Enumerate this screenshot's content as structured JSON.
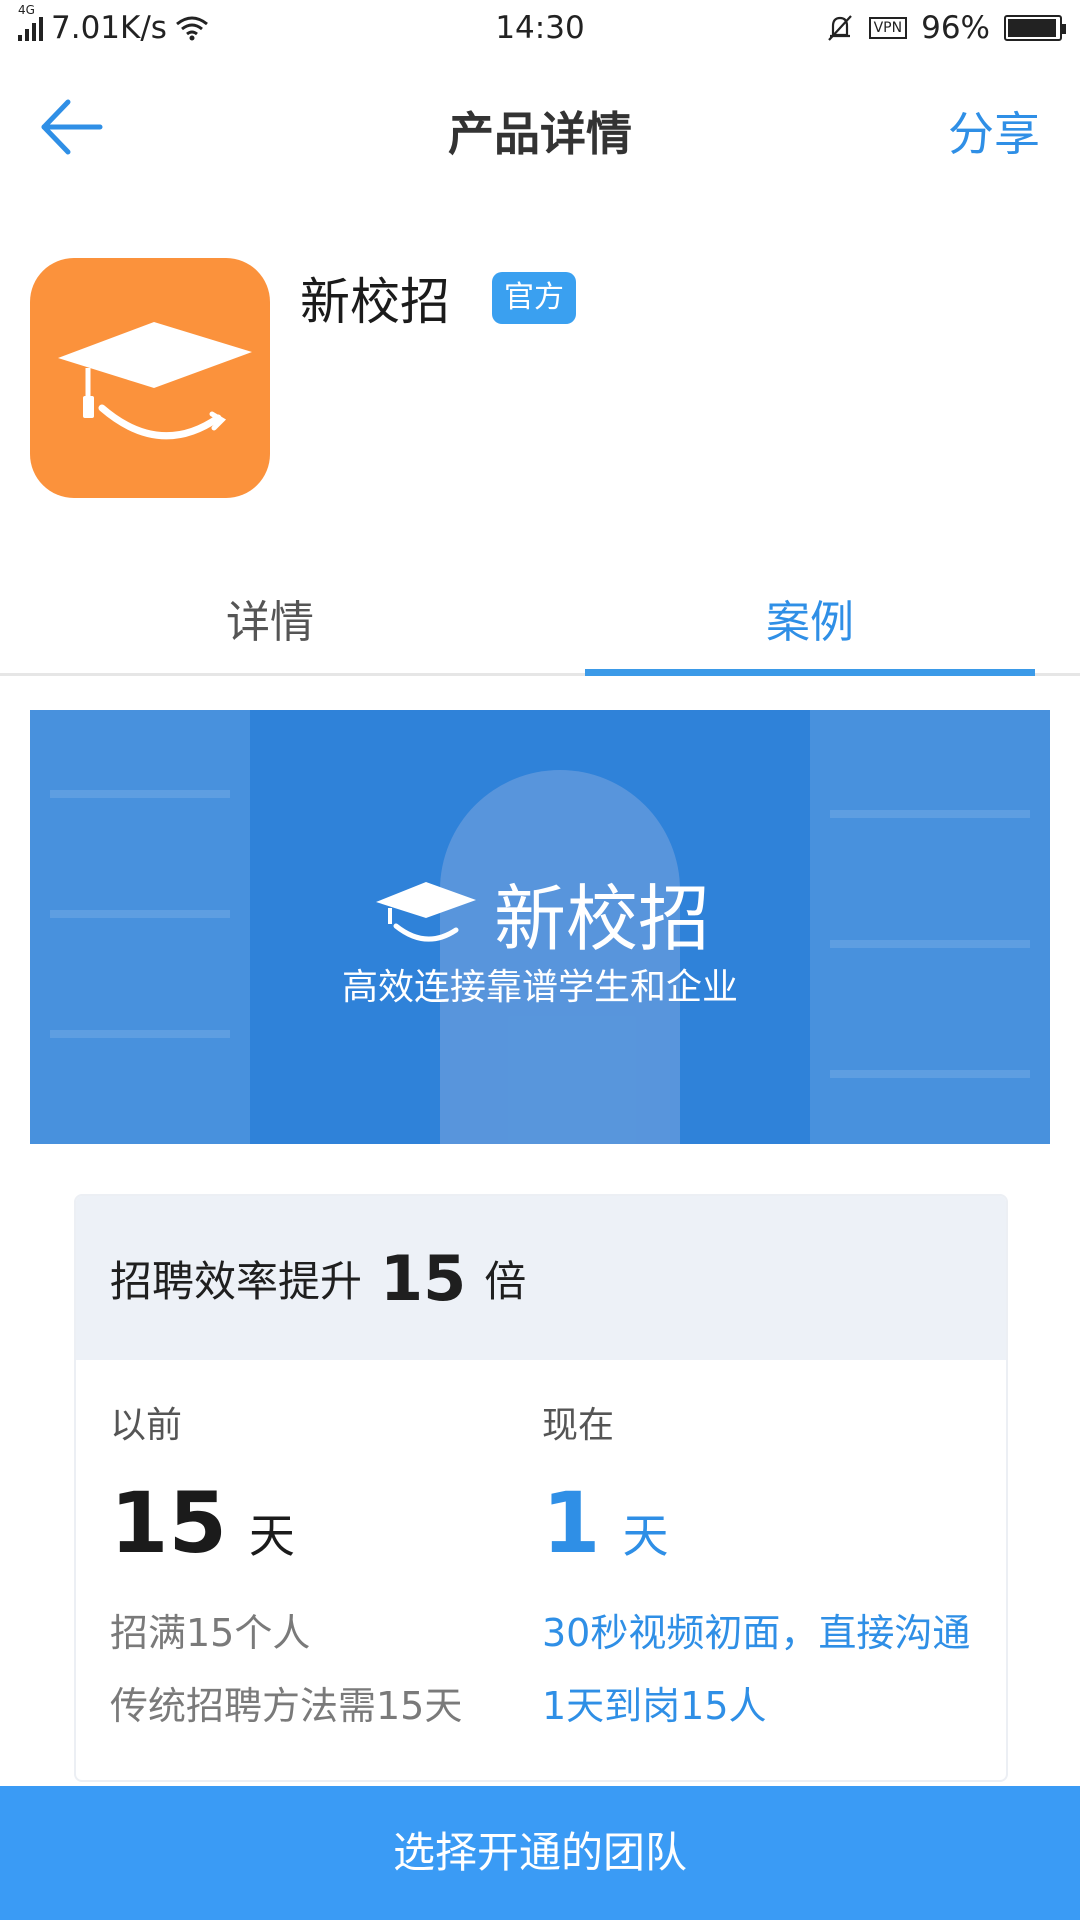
{
  "status_bar": {
    "network_type": "4G",
    "speed": "7.01K/s",
    "time": "14:30",
    "vpn": "VPN",
    "battery": "96%",
    "battery_level": 0.96
  },
  "nav": {
    "title": "产品详情",
    "share_label": "分享"
  },
  "product": {
    "name": "新校招",
    "badge": "官方",
    "icon_color": "#fb923c"
  },
  "tabs": [
    {
      "label": "详情",
      "active": false
    },
    {
      "label": "案例",
      "active": true
    }
  ],
  "banner": {
    "title": "新校招",
    "subtitle": "高效连接靠谱学生和企业"
  },
  "case_card": {
    "headline_prefix": "招聘效率提升",
    "headline_number": "15",
    "headline_suffix": "倍",
    "before": {
      "label": "以前",
      "number": "15",
      "unit": "天",
      "lines": [
        "招满15个人",
        "传统招聘方法需15天"
      ]
    },
    "now": {
      "label": "现在",
      "number": "1",
      "unit": "天",
      "lines": [
        "30秒视频初面，直接沟通",
        "1天到岗15人"
      ]
    }
  },
  "bottom_button": {
    "label": "选择开通的团队"
  },
  "colors": {
    "accent": "#2f8fe6",
    "button": "#3a9bf5",
    "banner": "#2f82d9"
  }
}
